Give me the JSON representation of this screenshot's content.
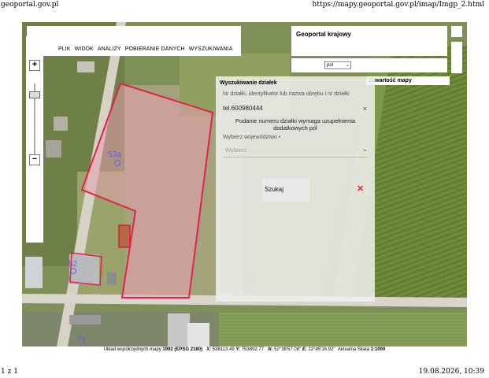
{
  "print": {
    "site": "geoportal.gov.pl",
    "url": "https://mapy.geoportal.gov.pl/imap/Imgp_2.html",
    "page": "1 z 1",
    "datetime": "19.08.2026, 10:39"
  },
  "menu": {
    "items": [
      "PLIK",
      "WIDOK",
      "ANALIZY",
      "POBIERANIE DANYCH",
      "WYSZUKIWANIA"
    ]
  },
  "header": {
    "title": "Geoportal krajowy"
  },
  "language": {
    "value": "pol"
  },
  "layers": {
    "label": "Zawartość mapy"
  },
  "zoom": {
    "in": "+",
    "out": "−"
  },
  "search": {
    "title": "Wyszukiwanie działek",
    "placeholder": "Nr działki, identyfikator lub nazwa obrębu i nr działki",
    "input_value": "tel.600980444",
    "clear": "×",
    "note": "Podanie numeru działki wymaga uzupełnienia dodatkowych pól",
    "voivodeship_label": "Wybierz województwo •",
    "voivodeship_value": "Wybierz",
    "search_button": "Szukaj",
    "close": "✕"
  },
  "map_labels": {
    "parcel_a": "53a",
    "parcel_b": "52",
    "parcel_c": "79",
    "parcel_d": "51"
  },
  "status": {
    "crs_label": "Układ współrzędnych mapy",
    "crs_value": "1992 (EPSG 2180)",
    "x_label": "X:",
    "x_value": "538113.49",
    "y_label": "Y:",
    "y_value": "753892.77",
    "n_label": "N:",
    "n_value": "52°38'57.08\"",
    "e_label": "E:",
    "e_value": "22°45'16.92\"",
    "scale_label": "Aktualna Skala",
    "scale_value": "1:1000"
  },
  "colors": {
    "parcel_outline": "#e0224e",
    "parcel_fill": "#e8a0b0",
    "close_icon": "#d22222",
    "field_green": "#6f8a3a"
  }
}
